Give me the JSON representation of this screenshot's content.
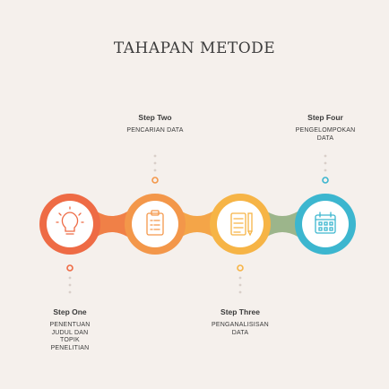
{
  "title": "TAHAPAN METODE",
  "steps": [
    {
      "name": "Step One",
      "desc": "PENENTUAN JUDUL DAN TOPIK PENELITIAN",
      "icon": "lightbulb-icon",
      "color": "#ee6b45",
      "position": "bottom"
    },
    {
      "name": "Step Two",
      "desc": "PENCARIAN DATA",
      "icon": "clipboard-checklist-icon",
      "color": "#f3974a",
      "position": "top"
    },
    {
      "name": "Step Three",
      "desc": "PENGANALISISAN DATA",
      "icon": "notebook-pencil-icon",
      "color": "#f6b446",
      "position": "bottom"
    },
    {
      "name": "Step Four",
      "desc": "PENGELOMPOKAN DATA",
      "icon": "calendar-grid-icon",
      "color": "#3cb6cf",
      "position": "top"
    }
  ]
}
